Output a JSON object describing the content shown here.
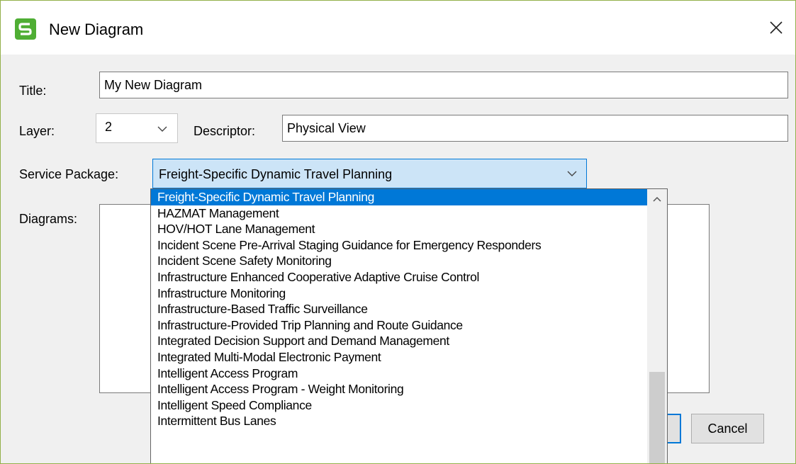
{
  "window": {
    "title": "New Diagram",
    "close_symbol": "✕"
  },
  "form": {
    "title_label": "Title:",
    "title_value": "My New Diagram",
    "layer_label": "Layer:",
    "layer_value": "2",
    "descriptor_label": "Descriptor:",
    "descriptor_value": "Physical View",
    "service_package_label": "Service Package:",
    "service_package_value": "Freight-Specific Dynamic Travel Planning",
    "diagrams_label": "Diagrams:"
  },
  "buttons": {
    "cancel": "Cancel"
  },
  "dropdown": {
    "items": [
      "Freight-Specific Dynamic Travel Planning",
      "HAZMAT Management",
      "HOV/HOT Lane Management",
      "Incident Scene Pre-Arrival Staging Guidance for Emergency Responders",
      "Incident Scene Safety Monitoring",
      "Infrastructure Enhanced Cooperative Adaptive Cruise Control",
      "Infrastructure Monitoring",
      "Infrastructure-Based Traffic Surveillance",
      "Infrastructure-Provided Trip Planning and Route Guidance",
      "Integrated Decision Support and Demand Management",
      "Integrated Multi-Modal Electronic Payment",
      "Intelligent Access Program",
      "Intelligent Access Program - Weight Monitoring",
      "Intelligent Speed Compliance",
      "Intermittent Bus Lanes"
    ],
    "selected_index": 0
  },
  "colors": {
    "accent": "#0078d7",
    "combo_highlight": "#cce4f7",
    "app_icon": "#4fae34"
  },
  "icons": {
    "app": "app-logo-icon",
    "close": "close-icon",
    "dropdown": "chevron-down-icon",
    "scroll_up": "chevron-up-icon"
  }
}
